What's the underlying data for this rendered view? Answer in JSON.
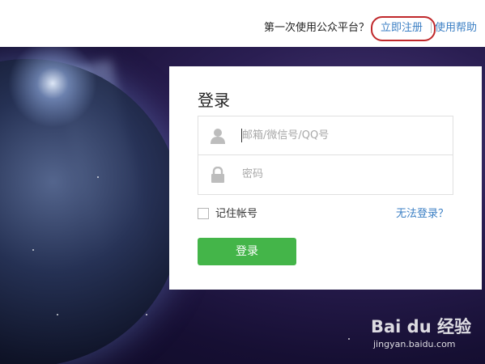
{
  "header": {
    "intro_text": "第一次使用公众平台？",
    "register_link": "立即注册",
    "help_link": "使用帮助"
  },
  "login": {
    "title": "登录",
    "account_placeholder": "邮箱/微信号/QQ号",
    "password_placeholder": "密码",
    "remember_label": "记住帐号",
    "forgot_link": "无法登录？",
    "submit_label": "登录"
  },
  "icons": {
    "user": "user-icon",
    "lock": "lock-icon"
  },
  "colors": {
    "link": "#3b7fc4",
    "button": "#44b549",
    "annotation": "#c0282b"
  },
  "watermark": {
    "brand": "Bai du 经验",
    "url": "jingyan.baidu.com"
  }
}
